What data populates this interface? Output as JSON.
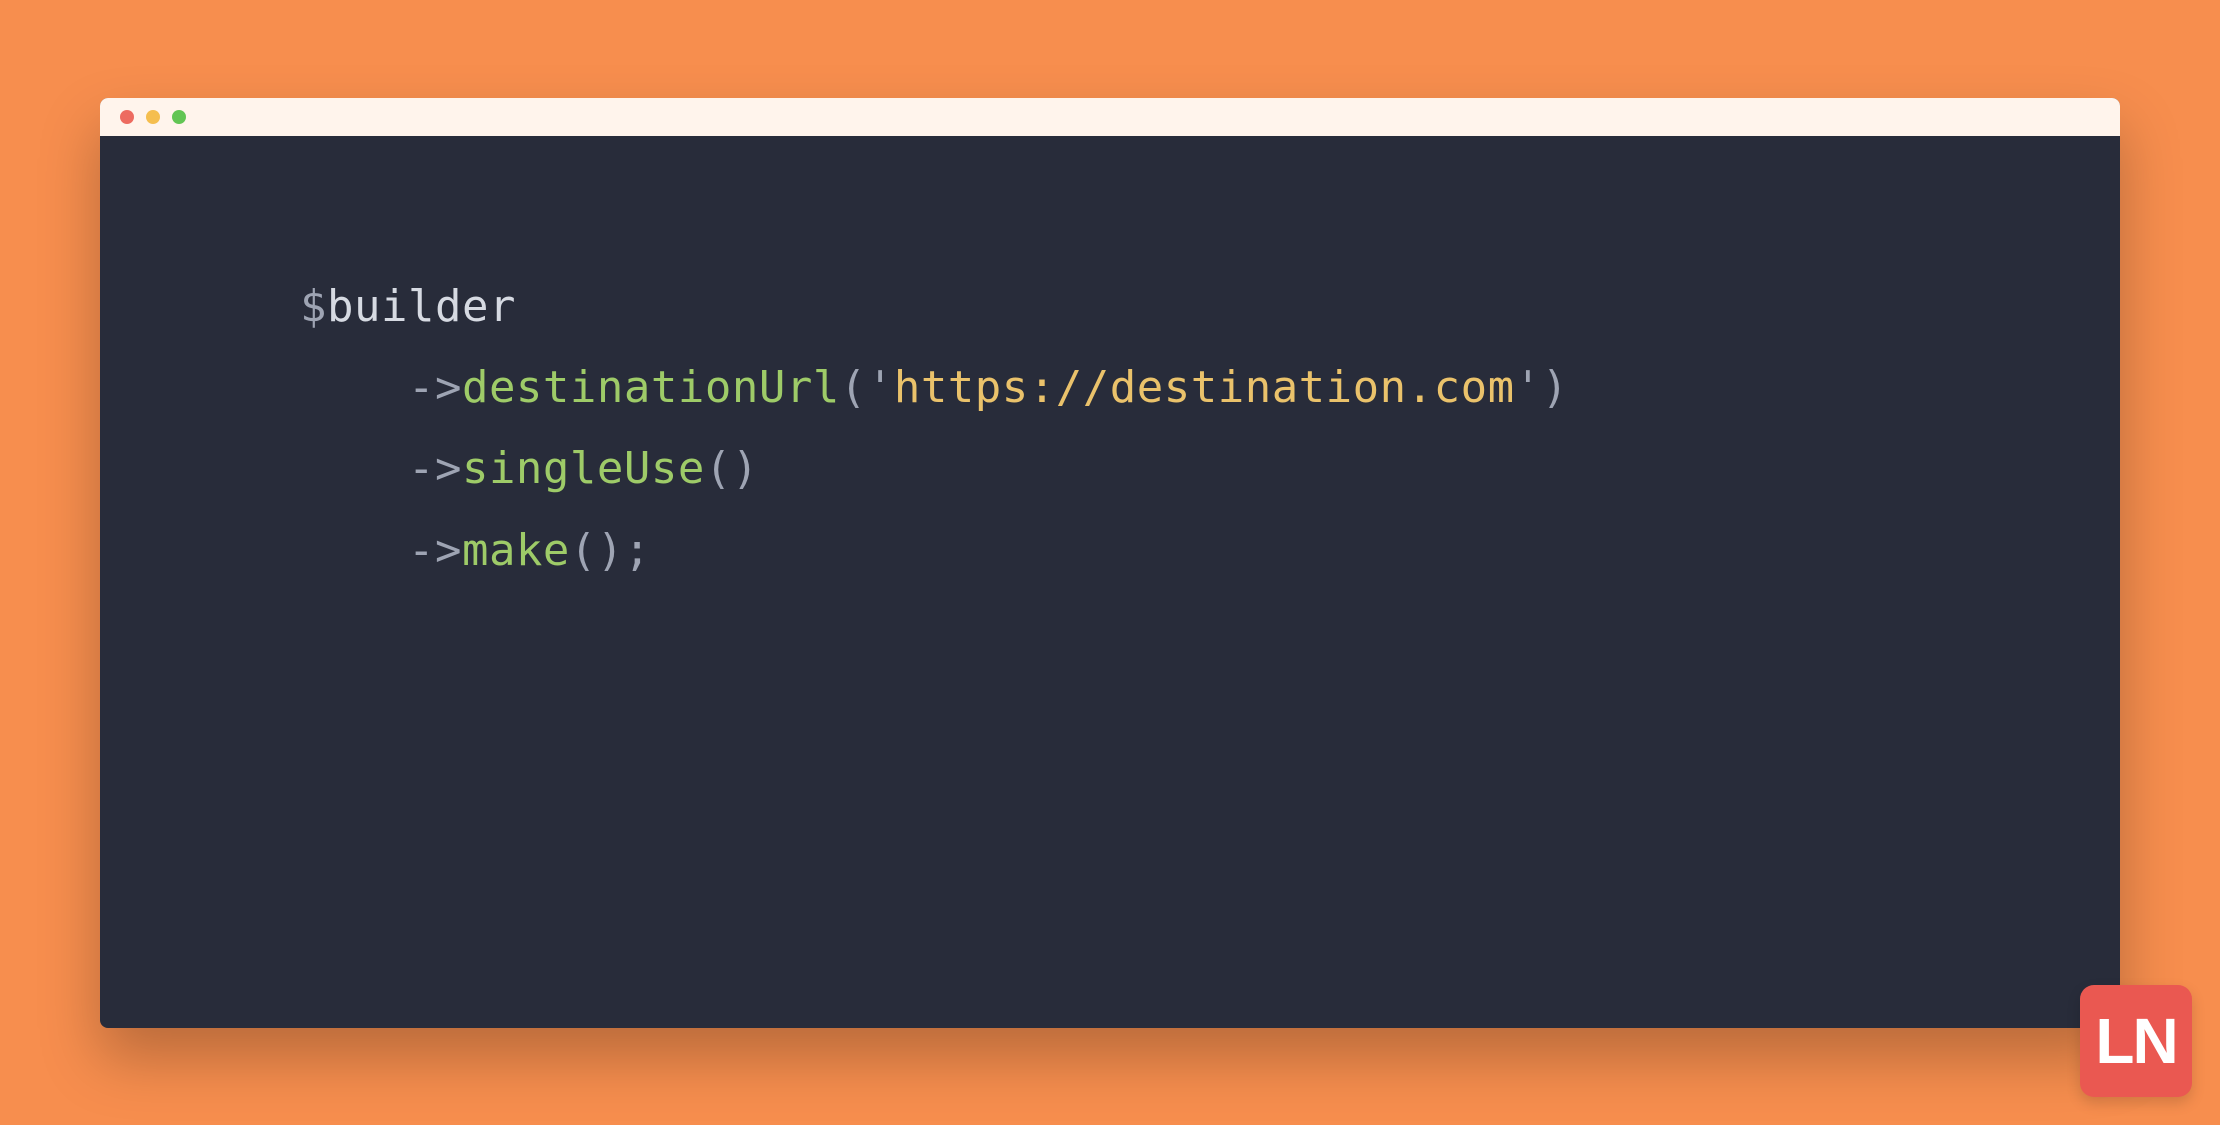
{
  "colors": {
    "background": "#f78e4e",
    "window_bg": "#282c3a",
    "titlebar_bg": "#fff4ec",
    "badge_bg": "#ea5851",
    "punct": "#9ea4b3",
    "var": "#d6dae2",
    "method": "#9ecb68",
    "string": "#eac26b"
  },
  "code": {
    "line1": {
      "dollar": "$",
      "var": "builder"
    },
    "line2": {
      "indent": "    ",
      "arrow": "->",
      "method": "destinationUrl",
      "open": "(",
      "quote1": "'",
      "string": "https://destination.com",
      "quote2": "'",
      "close": ")"
    },
    "line3": {
      "indent": "    ",
      "arrow": "->",
      "method": "singleUse",
      "parens": "()"
    },
    "line4": {
      "indent": "    ",
      "arrow": "->",
      "method": "make",
      "parens": "();"
    }
  },
  "logo": {
    "text": "LN"
  }
}
